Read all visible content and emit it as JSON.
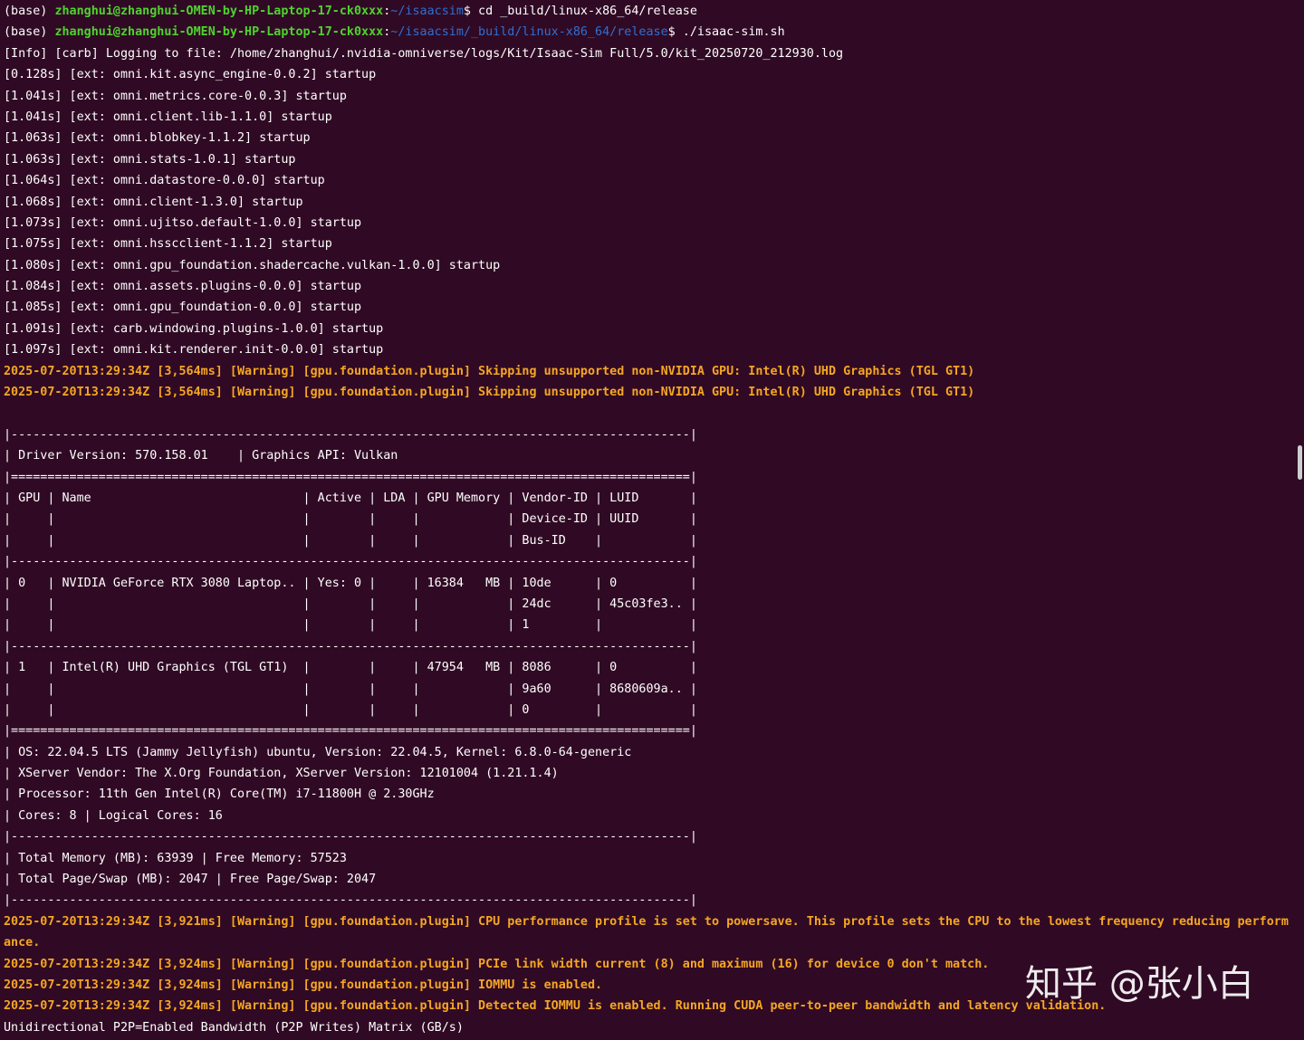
{
  "colors": {
    "background": "#300a24",
    "text": "#ffffff",
    "prompt_user": "#4fd32f",
    "prompt_path": "#2f6fd3",
    "warning": "#f5a623"
  },
  "terminal": {
    "lines": [
      {
        "type": "prompt",
        "env": "(base) ",
        "user": "zhanghui@zhanghui-OMEN-by-HP-Laptop-17-ck0xxx",
        "sep": ":",
        "path": "~/isaacsim",
        "cmd": "$ cd _build/linux-x86_64/release"
      },
      {
        "type": "prompt",
        "env": "(base) ",
        "user": "zhanghui@zhanghui-OMEN-by-HP-Laptop-17-ck0xxx",
        "sep": ":",
        "path": "~/isaacsim/_build/linux-x86_64/release",
        "cmd": "$ ./isaac-sim.sh"
      },
      {
        "type": "normal",
        "text": "[Info] [carb] Logging to file: /home/zhanghui/.nvidia-omniverse/logs/Kit/Isaac-Sim Full/5.0/kit_20250720_212930.log"
      },
      {
        "type": "normal",
        "text": "[0.128s] [ext: omni.kit.async_engine-0.0.2] startup"
      },
      {
        "type": "normal",
        "text": "[1.041s] [ext: omni.metrics.core-0.0.3] startup"
      },
      {
        "type": "normal",
        "text": "[1.041s] [ext: omni.client.lib-1.1.0] startup"
      },
      {
        "type": "normal",
        "text": "[1.063s] [ext: omni.blobkey-1.1.2] startup"
      },
      {
        "type": "normal",
        "text": "[1.063s] [ext: omni.stats-1.0.1] startup"
      },
      {
        "type": "normal",
        "text": "[1.064s] [ext: omni.datastore-0.0.0] startup"
      },
      {
        "type": "normal",
        "text": "[1.068s] [ext: omni.client-1.3.0] startup"
      },
      {
        "type": "normal",
        "text": "[1.073s] [ext: omni.ujitso.default-1.0.0] startup"
      },
      {
        "type": "normal",
        "text": "[1.075s] [ext: omni.hsscclient-1.1.2] startup"
      },
      {
        "type": "normal",
        "text": "[1.080s] [ext: omni.gpu_foundation.shadercache.vulkan-1.0.0] startup"
      },
      {
        "type": "normal",
        "text": "[1.084s] [ext: omni.assets.plugins-0.0.0] startup"
      },
      {
        "type": "normal",
        "text": "[1.085s] [ext: omni.gpu_foundation-0.0.0] startup"
      },
      {
        "type": "normal",
        "text": "[1.091s] [ext: carb.windowing.plugins-1.0.0] startup"
      },
      {
        "type": "normal",
        "text": "[1.097s] [ext: omni.kit.renderer.init-0.0.0] startup"
      },
      {
        "type": "warn",
        "text": "2025-07-20T13:29:34Z [3,564ms] [Warning] [gpu.foundation.plugin] Skipping unsupported non-NVIDIA GPU: Intel(R) UHD Graphics (TGL GT1)"
      },
      {
        "type": "warn",
        "text": "2025-07-20T13:29:34Z [3,564ms] [Warning] [gpu.foundation.plugin] Skipping unsupported non-NVIDIA GPU: Intel(R) UHD Graphics (TGL GT1)"
      },
      {
        "type": "normal",
        "text": ""
      },
      {
        "type": "normal",
        "text": "|---------------------------------------------------------------------------------------------|"
      },
      {
        "type": "normal",
        "text": "| Driver Version: 570.158.01    | Graphics API: Vulkan"
      },
      {
        "type": "normal",
        "text": "|=============================================================================================|"
      },
      {
        "type": "normal",
        "text": "| GPU | Name                             | Active | LDA | GPU Memory | Vendor-ID | LUID       |"
      },
      {
        "type": "normal",
        "text": "|     |                                  |        |     |            | Device-ID | UUID       |"
      },
      {
        "type": "normal",
        "text": "|     |                                  |        |     |            | Bus-ID    |            |"
      },
      {
        "type": "normal",
        "text": "|---------------------------------------------------------------------------------------------|"
      },
      {
        "type": "normal",
        "text": "| 0   | NVIDIA GeForce RTX 3080 Laptop.. | Yes: 0 |     | 16384   MB | 10de      | 0          |"
      },
      {
        "type": "normal",
        "text": "|     |                                  |        |     |            | 24dc      | 45c03fe3.. |"
      },
      {
        "type": "normal",
        "text": "|     |                                  |        |     |            | 1         |            |"
      },
      {
        "type": "normal",
        "text": "|---------------------------------------------------------------------------------------------|"
      },
      {
        "type": "normal",
        "text": "| 1   | Intel(R) UHD Graphics (TGL GT1)  |        |     | 47954   MB | 8086      | 0          |"
      },
      {
        "type": "normal",
        "text": "|     |                                  |        |     |            | 9a60      | 8680609a.. |"
      },
      {
        "type": "normal",
        "text": "|     |                                  |        |     |            | 0         |            |"
      },
      {
        "type": "normal",
        "text": "|=============================================================================================|"
      },
      {
        "type": "normal",
        "text": "| OS: 22.04.5 LTS (Jammy Jellyfish) ubuntu, Version: 22.04.5, Kernel: 6.8.0-64-generic"
      },
      {
        "type": "normal",
        "text": "| XServer Vendor: The X.Org Foundation, XServer Version: 12101004 (1.21.1.4)"
      },
      {
        "type": "normal",
        "text": "| Processor: 11th Gen Intel(R) Core(TM) i7-11800H @ 2.30GHz"
      },
      {
        "type": "normal",
        "text": "| Cores: 8 | Logical Cores: 16"
      },
      {
        "type": "normal",
        "text": "|---------------------------------------------------------------------------------------------|"
      },
      {
        "type": "normal",
        "text": "| Total Memory (MB): 63939 | Free Memory: 57523"
      },
      {
        "type": "normal",
        "text": "| Total Page/Swap (MB): 2047 | Free Page/Swap: 2047"
      },
      {
        "type": "normal",
        "text": "|---------------------------------------------------------------------------------------------|"
      },
      {
        "type": "warn",
        "text": "2025-07-20T13:29:34Z [3,921ms] [Warning] [gpu.foundation.plugin] CPU performance profile is set to powersave. This profile sets the CPU to the lowest frequency reducing perform"
      },
      {
        "type": "warn",
        "text": "ance."
      },
      {
        "type": "warn",
        "text": "2025-07-20T13:29:34Z [3,924ms] [Warning] [gpu.foundation.plugin] PCIe link width current (8) and maximum (16) for device 0 don't match."
      },
      {
        "type": "warn",
        "text": "2025-07-20T13:29:34Z [3,924ms] [Warning] [gpu.foundation.plugin] IOMMU is enabled."
      },
      {
        "type": "warn",
        "text": "2025-07-20T13:29:34Z [3,924ms] [Warning] [gpu.foundation.plugin] Detected IOMMU is enabled. Running CUDA peer-to-peer bandwidth and latency validation."
      },
      {
        "type": "normal",
        "text": "Unidirectional P2P=Enabled Bandwidth (P2P Writes) Matrix (GB/s)"
      }
    ]
  },
  "watermark": {
    "text": "知乎 @张小白"
  }
}
